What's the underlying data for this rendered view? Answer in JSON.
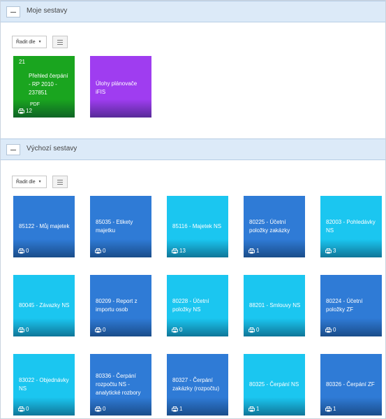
{
  "sections": {
    "my": {
      "title": "Moje sestavy",
      "sort_label": "Řadit dle",
      "tiles": [
        {
          "number": "21",
          "label": "Přehled čerpání - RP 2010 - 237851",
          "pdf": "PDF",
          "count": "12",
          "color": "green"
        },
        {
          "label": "Úlohy plánovače iFIS",
          "color": "purple"
        }
      ]
    },
    "default": {
      "title": "Výchozí sestavy",
      "sort_label": "Řadit dle",
      "tiles": [
        {
          "label": "85122 - Můj majetek",
          "count": "0",
          "color": "blue-dark"
        },
        {
          "label": "85035 - Etikety majetku",
          "count": "0",
          "color": "blue-dark"
        },
        {
          "label": "85116 - Majetek NS",
          "count": "13",
          "color": "blue-light"
        },
        {
          "label": "80225 - Účetní položky zakázky",
          "count": "1",
          "color": "blue-dark"
        },
        {
          "label": "82003 - Pohledávky NS",
          "count": "3",
          "color": "blue-light"
        },
        {
          "label": "80045 - Závazky NS",
          "count": "0",
          "color": "blue-light"
        },
        {
          "label": "80209 - Report z importu osob",
          "count": "0",
          "color": "blue-dark"
        },
        {
          "label": "80228 - Účetní položky NS",
          "count": "0",
          "color": "blue-light"
        },
        {
          "label": "88201 - Smlouvy NS",
          "count": "0",
          "color": "blue-light"
        },
        {
          "label": "80224 - Účetní položky ZF",
          "count": "0",
          "color": "blue-dark"
        },
        {
          "label": "83022 - Objednávky NS",
          "count": "0",
          "color": "blue-light"
        },
        {
          "label": "80336 - Čerpání rozpočtu NS - analytické rozbory",
          "count": "0",
          "color": "blue-dark"
        },
        {
          "label": "80327 - Čerpání zakázky (rozpočtu)",
          "count": "1",
          "color": "blue-dark"
        },
        {
          "label": "80325 - Čerpání NS",
          "count": "1",
          "color": "blue-light"
        },
        {
          "label": "80326 - Čerpání ZF",
          "count": "1",
          "color": "blue-dark"
        }
      ]
    }
  }
}
